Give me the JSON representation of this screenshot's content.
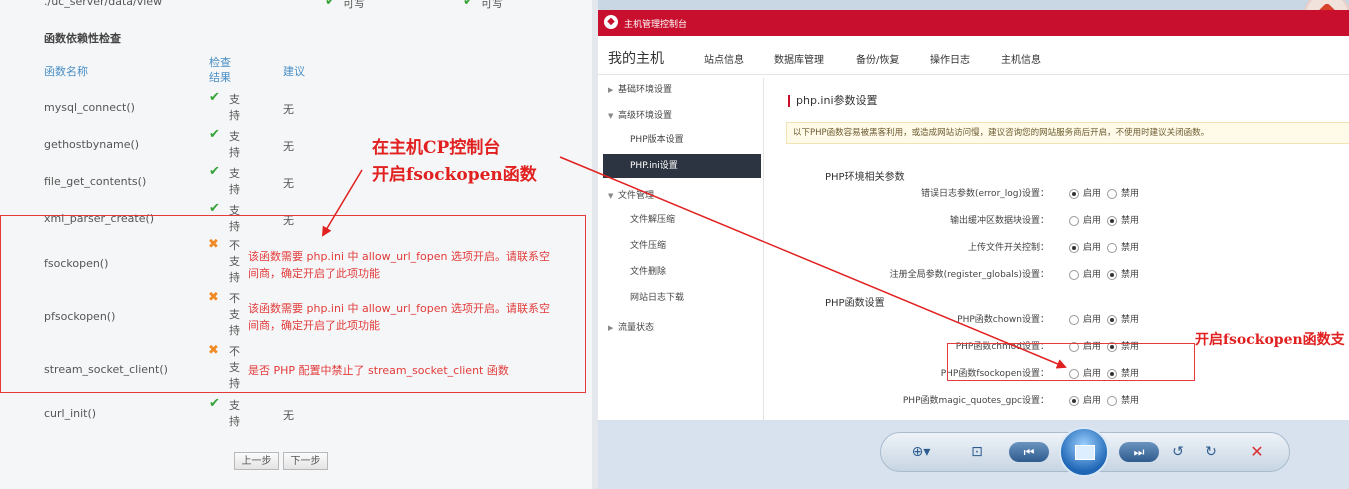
{
  "left": {
    "path_row": {
      "name": "./uc_server/data/view",
      "status1": "可写",
      "status2": "可写"
    },
    "section_title": "函数依赖性检查",
    "headers": {
      "name": "函数名称",
      "check": "检查结果",
      "suggest": "建议"
    },
    "rows": [
      {
        "name": "mysql_connect()",
        "status": "ok",
        "result": "支持",
        "suggest": "无"
      },
      {
        "name": "gethostbyname()",
        "status": "ok",
        "result": "支持",
        "suggest": "无"
      },
      {
        "name": "file_get_contents()",
        "status": "ok",
        "result": "支持",
        "suggest": "无"
      },
      {
        "name": "xml_parser_create()",
        "status": "ok",
        "result": "支持",
        "suggest": "无"
      },
      {
        "name": "fsockopen()",
        "status": "bad",
        "result": "不支持",
        "suggest": "该函数需要 php.ini 中 allow_url_fopen 选项开启。请联系空间商，确定开启了此项功能"
      },
      {
        "name": "pfsockopen()",
        "status": "bad",
        "result": "不支持",
        "suggest": "该函数需要 php.ini 中 allow_url_fopen 选项开启。请联系空间商，确定开启了此项功能"
      },
      {
        "name": "stream_socket_client()",
        "status": "bad",
        "result": "不支持",
        "suggest": "是否 PHP 配置中禁止了 stream_socket_client 函数"
      },
      {
        "name": "curl_init()",
        "status": "ok",
        "result": "支持",
        "suggest": "无"
      }
    ],
    "buttons": {
      "prev": "上一步",
      "next": "下一步"
    }
  },
  "annotations": {
    "left_line1": "在主机CP控制台",
    "left_line2": "开启fsockopen函数",
    "right": "开启fsockopen函数支"
  },
  "console": {
    "title": "主机管理控制台",
    "nav_main": "我的主机",
    "nav": [
      "站点信息",
      "数据库管理",
      "备份/恢复",
      "操作日志",
      "主机信息"
    ],
    "sidebar": {
      "basic": "基础环境设置",
      "advanced": "高级环境设置",
      "php_version": "PHP版本设置",
      "php_ini": "PHP.ini设置",
      "file_mgmt": "文件管理",
      "unzip": "文件解压缩",
      "zip": "文件压缩",
      "delete": "文件删除",
      "logs": "网站日志下载",
      "traffic": "流量状态"
    },
    "page_title": "php.ini参数设置",
    "notice": "以下PHP函数容易被黑客利用，或造成网站访问慢，建议咨询您的网站服务商后开启，不使用时建议关闭函数。",
    "env_group": "PHP环境相关参数",
    "env_params": [
      {
        "label": "错误日志参数(error_log)设置：",
        "selected": "on"
      },
      {
        "label": "输出缓冲区数据块设置：",
        "selected": "off"
      },
      {
        "label": "上传文件开关控制：",
        "selected": "on"
      },
      {
        "label": "注册全局参数(register_globals)设置：",
        "selected": "off"
      }
    ],
    "func_group": "PHP函数设置",
    "func_params": [
      {
        "label": "PHP函数chown设置：",
        "selected": "off"
      },
      {
        "label": "PHP函数chmod设置：",
        "selected": "off"
      },
      {
        "label": "PHP函数fsockopen设置：",
        "selected": "off"
      },
      {
        "label": "PHP函数magic_quotes_gpc设置：",
        "selected": "on"
      }
    ],
    "enable": "启用",
    "disable": "禁用"
  },
  "toolbar_icons": [
    "zoom-icon",
    "fit-icon",
    "previous-icon",
    "slideshow-icon",
    "next-icon",
    "rotate-left-icon",
    "rotate-right-icon",
    "delete-icon"
  ]
}
